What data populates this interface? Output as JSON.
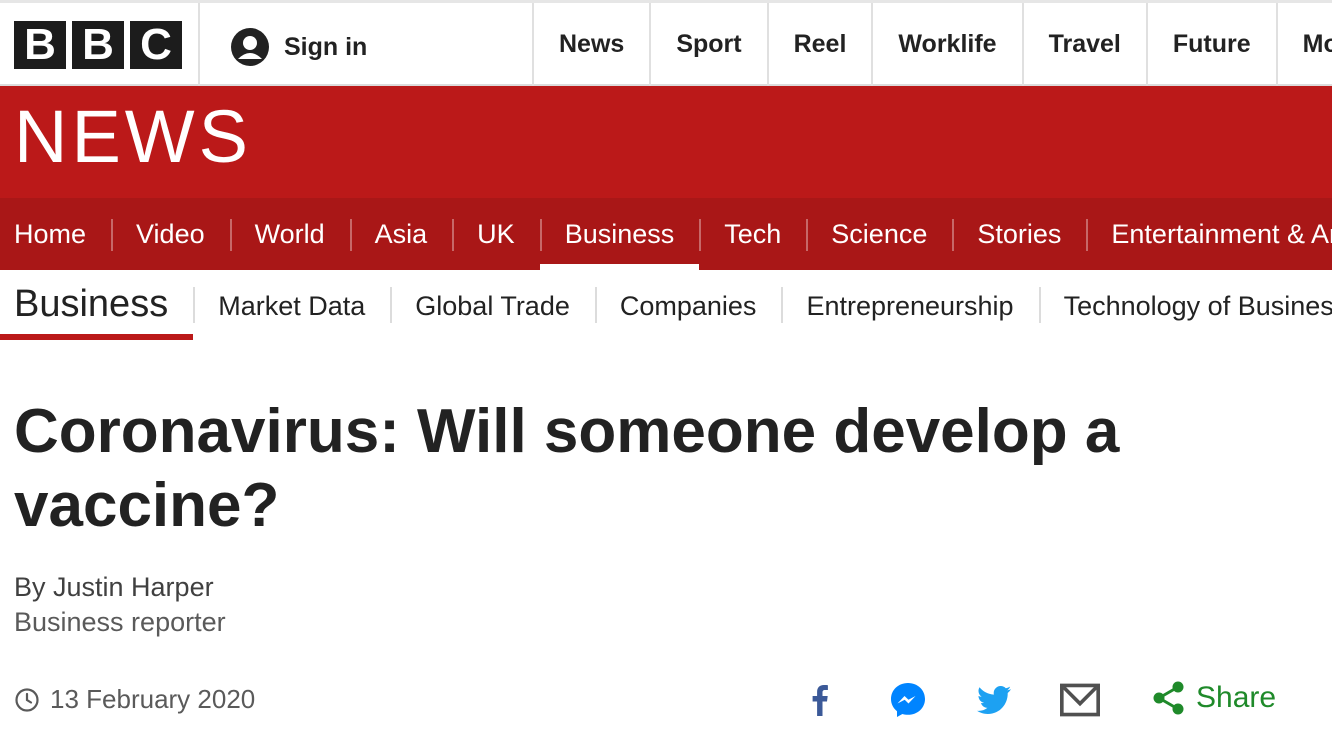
{
  "brand": {
    "logo_letters": [
      "B",
      "B",
      "C"
    ],
    "masthead": "NEWS",
    "colors": {
      "red": "#bb1919",
      "dark_red": "#a91717",
      "share_green": "#1f8a2a",
      "facebook": "#3b5998",
      "messenger": "#0084ff",
      "twitter": "#1da1f2"
    }
  },
  "header": {
    "signin_label": "Sign in",
    "signin_icon": "user-icon",
    "global_nav": [
      "News",
      "Sport",
      "Reel",
      "Worklife",
      "Travel",
      "Future",
      "More"
    ]
  },
  "section_nav": {
    "items": [
      "Home",
      "Video",
      "World",
      "Asia",
      "UK",
      "Business",
      "Tech",
      "Science",
      "Stories",
      "Entertainment & Arts"
    ],
    "active": "Business"
  },
  "sub_nav": {
    "section_title": "Business",
    "items": [
      "Market Data",
      "Global Trade",
      "Companies",
      "Entrepreneurship",
      "Technology of Business"
    ]
  },
  "article": {
    "headline": "Coronavirus: Will someone develop a vaccine?",
    "author": "By Justin Harper",
    "author_role": "Business reporter",
    "date": "13 February 2020",
    "date_icon": "clock-icon"
  },
  "share": {
    "icons": [
      "facebook-icon",
      "messenger-icon",
      "twitter-icon",
      "email-icon"
    ],
    "label": "Share"
  }
}
